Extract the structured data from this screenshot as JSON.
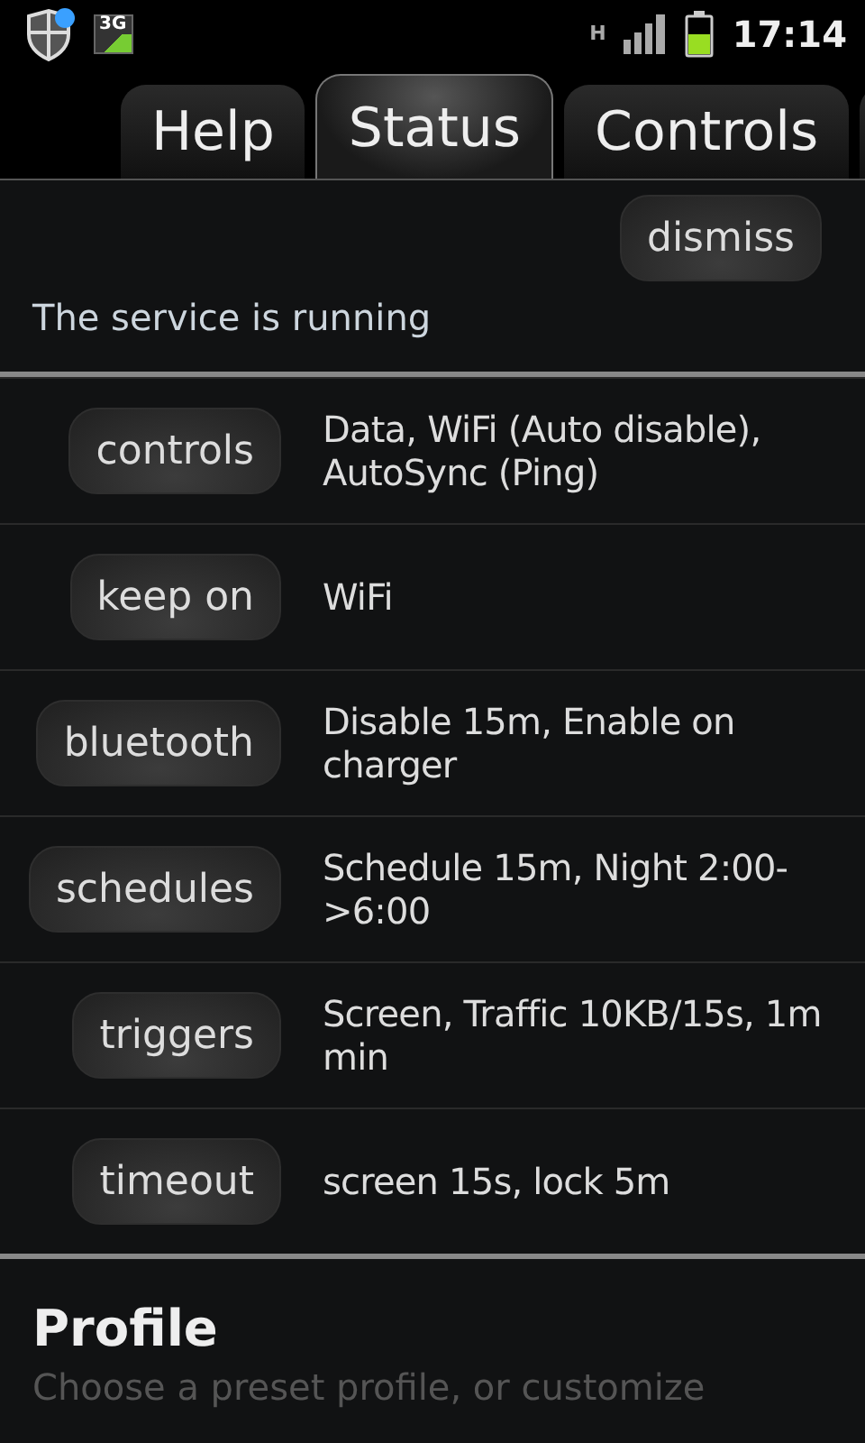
{
  "status_bar": {
    "network": "3G",
    "data": "H",
    "time": "17:14",
    "notification": true
  },
  "tabs": [
    {
      "label": "Help",
      "selected": false
    },
    {
      "label": "Status",
      "selected": true
    },
    {
      "label": "Controls",
      "selected": false
    }
  ],
  "notice": {
    "button": "dismiss",
    "message": "The service is running"
  },
  "rows": [
    {
      "button": "controls",
      "detail": "Data, WiFi (Auto disable), AutoSync (Ping)"
    },
    {
      "button": "keep on",
      "detail": "WiFi"
    },
    {
      "button": "bluetooth",
      "detail": "Disable 15m, Enable on charger"
    },
    {
      "button": "schedules",
      "detail": "Schedule 15m, Night 2:00->6:00"
    },
    {
      "button": "triggers",
      "detail": "Screen, Traffic 10KB/15s, 1m min"
    },
    {
      "button": "timeout",
      "detail": "screen 15s, lock 5m"
    }
  ],
  "profile": {
    "title": "Profile",
    "subtitle": "Choose a preset profile, or customize"
  }
}
